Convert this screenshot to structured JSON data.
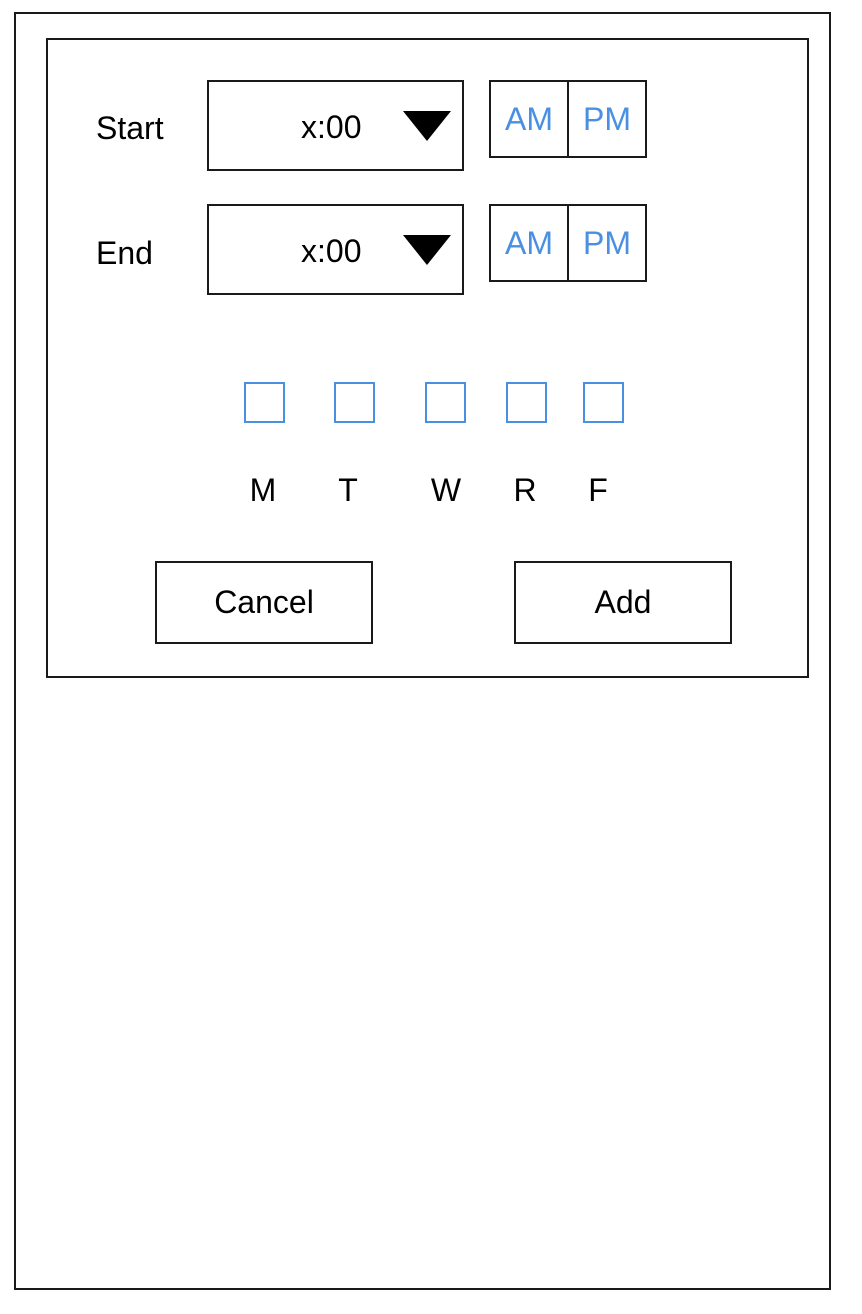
{
  "dialog": {
    "start": {
      "label": "Start",
      "time_value": "x:00",
      "am_label": "AM",
      "pm_label": "PM"
    },
    "end": {
      "label": "End",
      "time_value": "x:00",
      "am_label": "AM",
      "pm_label": "PM"
    },
    "days": [
      {
        "label": "M",
        "checked": false
      },
      {
        "label": "T",
        "checked": false
      },
      {
        "label": "W",
        "checked": false
      },
      {
        "label": "R",
        "checked": false
      },
      {
        "label": "F",
        "checked": false
      }
    ],
    "cancel_label": "Cancel",
    "add_label": "Add"
  },
  "colors": {
    "accent": "#4a90e2",
    "border": "#1a1a1a",
    "text": "#000000",
    "background": "#ffffff"
  },
  "icons": {
    "dropdown": "triangle-down-icon"
  }
}
